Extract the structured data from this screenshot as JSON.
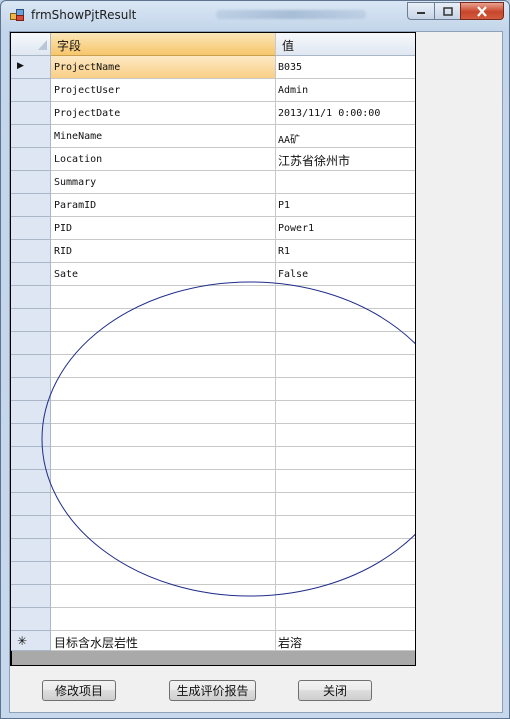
{
  "window": {
    "title": "frmShowPjtResult"
  },
  "grid": {
    "columns": [
      "字段",
      "值"
    ],
    "rows": [
      [
        "ProjectName",
        "B035"
      ],
      [
        "ProjectUser",
        "Admin"
      ],
      [
        "ProjectDate",
        "2013/11/1 0:00:00"
      ],
      [
        "MineName",
        "AA矿"
      ],
      [
        "Location",
        "江苏省徐州市"
      ],
      [
        "Summary",
        ""
      ],
      [
        "ParamID",
        "P1"
      ],
      [
        "PID",
        "Power1"
      ],
      [
        "RID",
        "R1"
      ],
      [
        "Sate",
        "False"
      ]
    ],
    "new_row": [
      "目标含水层岩性",
      "岩溶"
    ],
    "new_row_marker": "✳",
    "current_row_marker": "▶"
  },
  "buttons": {
    "edit": "修改项目",
    "report": "生成评价报告",
    "close": "关闭"
  },
  "colors": {
    "annotation": "#1f2d8a",
    "selected_header": "#f7c66b"
  }
}
